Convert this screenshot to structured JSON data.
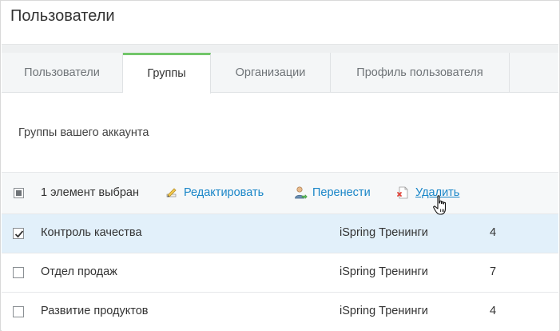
{
  "page": {
    "title": "Пользователи"
  },
  "tabs": [
    {
      "label": "Пользователи",
      "active": false
    },
    {
      "label": "Группы",
      "active": true
    },
    {
      "label": "Организации",
      "active": false
    },
    {
      "label": "Профиль пользователя",
      "active": false
    }
  ],
  "section": {
    "subtitle": "Группы вашего аккаунта"
  },
  "toolbar": {
    "selection_text": "1 элемент выбран",
    "edit_label": "Редактировать",
    "move_label": "Перенести",
    "delete_label": "Удалить"
  },
  "groups": [
    {
      "name": "Контроль качества",
      "organization": "iSpring Тренинги",
      "count": "4",
      "checked": true
    },
    {
      "name": "Отдел продаж",
      "organization": "iSpring Тренинги",
      "count": "7",
      "checked": false
    },
    {
      "name": "Развитие продуктов",
      "organization": "iSpring Тренинги",
      "count": "4",
      "checked": false
    }
  ],
  "colors": {
    "accent": "#72c66a",
    "link": "#1a86c8",
    "selected_row": "#e2f0fa"
  },
  "icons": [
    "pencil-icon",
    "user-move-icon",
    "delete-doc-icon",
    "hand-cursor-icon",
    "check-icon"
  ]
}
